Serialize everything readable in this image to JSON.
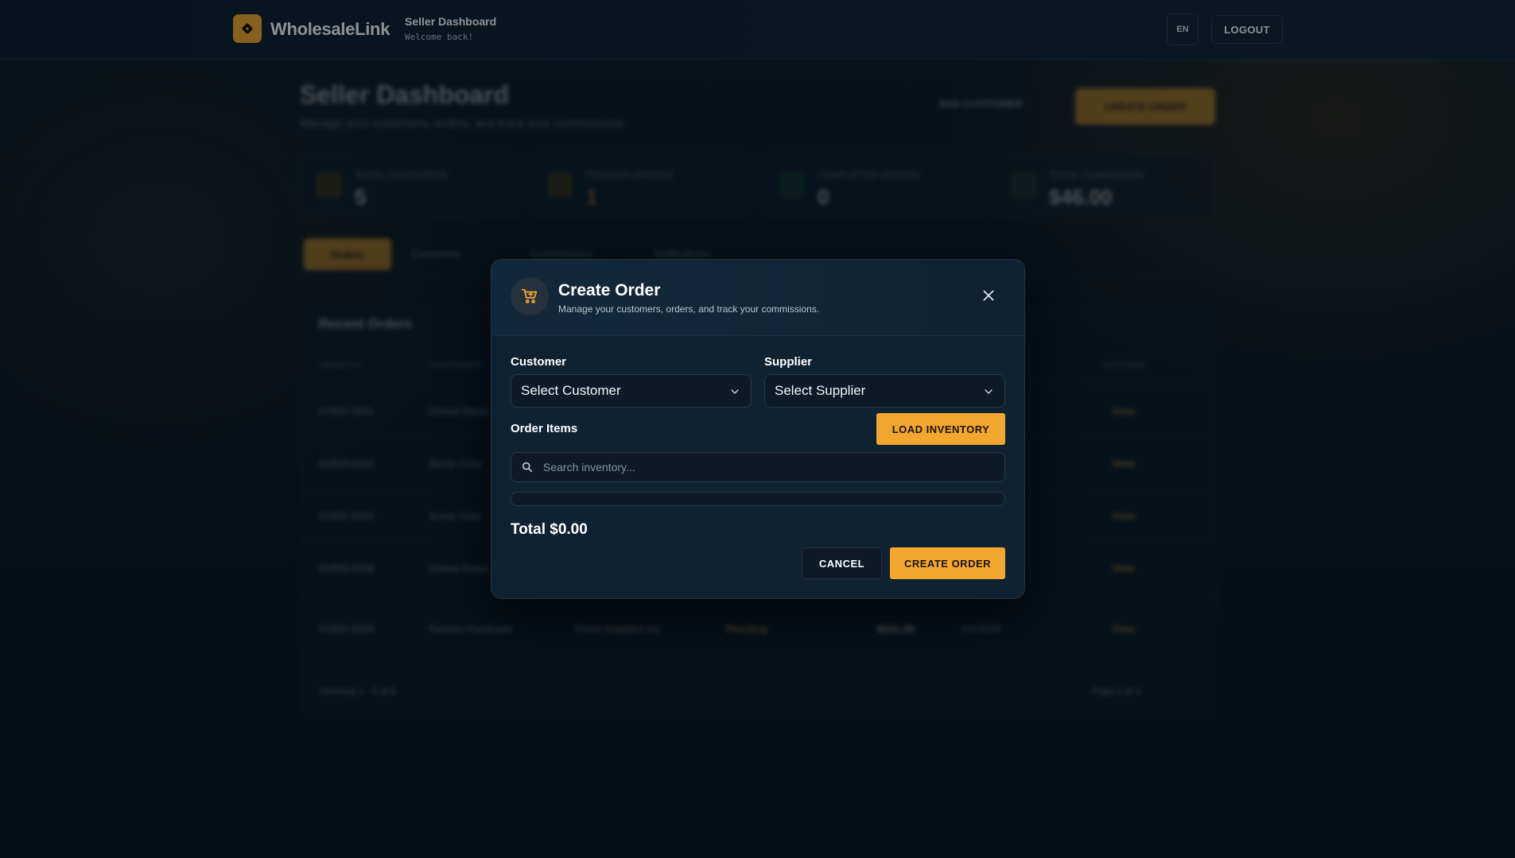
{
  "app": {
    "brand": "WholesaleLink",
    "nav_title": "Seller Dashboard",
    "nav_subtitle": "Welcome back!",
    "lang": "EN",
    "logout": "LOGOUT",
    "accent_color": "#f2a72e"
  },
  "dashboard": {
    "title": "Seller Dashboard",
    "subtitle": "Manage your customers, orders, and track your commissions.",
    "add_customer": "ADD CUSTOMER",
    "create_order": "CREATE ORDER",
    "stats": [
      {
        "label": "TOTAL CUSTOMERS",
        "value": "5"
      },
      {
        "label": "PENDING ORDERS",
        "value": "1"
      },
      {
        "label": "COMPLETED ORDERS",
        "value": "0"
      },
      {
        "label": "TOTAL COMMISSION",
        "value": "$46.00"
      }
    ],
    "tabs": [
      "Orders",
      "Customers",
      "Commissions",
      "Notifications"
    ],
    "table": {
      "title": "Recent Orders",
      "columns": [
        "ORDER #",
        "CUSTOMER",
        "ACTIONS"
      ],
      "rows": [
        {
          "order": "#ORD-0001",
          "customer": "Global Retail",
          "action": "View"
        },
        {
          "order": "#ORD-0002",
          "customer": "Acme Corp",
          "action": "View"
        },
        {
          "order": "#ORD-0003",
          "customer": "Acme Corp",
          "action": "View"
        },
        {
          "order": "#ORD-0004",
          "customer": "Global Retail",
          "action": "View"
        },
        {
          "order": "#ORD-0005",
          "customer": "Retailer Hardware",
          "supplier": "Prime Supplies Inc",
          "status": "Pending",
          "amount": "$241.00",
          "date": "2/1/2025",
          "action": "View"
        }
      ],
      "footer_left": "Showing 1 - 5 of 5",
      "footer_right": "Page 1 of 1"
    }
  },
  "modal": {
    "title": "Create Order",
    "subtitle": "Manage your customers, orders, and track your commissions.",
    "customer_label": "Customer",
    "customer_value": "Select Customer",
    "supplier_label": "Supplier",
    "supplier_value": "Select Supplier",
    "order_items_label": "Order Items",
    "load_inventory": "LOAD INVENTORY",
    "search_placeholder": "Search inventory...",
    "total": "Total $0.00",
    "cancel": "CANCEL",
    "create": "CREATE ORDER"
  }
}
